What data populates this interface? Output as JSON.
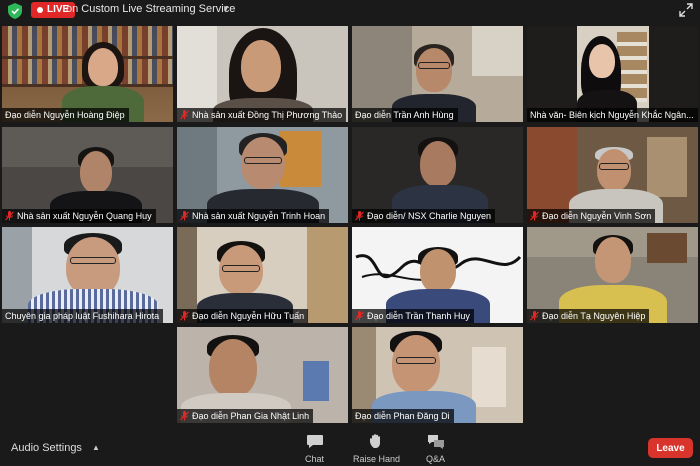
{
  "top_bar": {
    "live_label": "LIVE",
    "stream_text": "on Custom Live Streaming Service"
  },
  "participants": [
    {
      "name": "Đạo diễn Nguyễn Hoàng Điệp",
      "muted": false
    },
    {
      "name": "Nhà sản xuất Đồng Thị Phương Thảo",
      "muted": true
    },
    {
      "name": "Đạo diễn Trần Anh Hùng",
      "muted": false
    },
    {
      "name": "Nhà văn- Biên kịch Nguyễn Khắc Ngân...",
      "muted": false
    },
    {
      "name": "Nhà sản xuất Nguyễn Quang Huy",
      "muted": true
    },
    {
      "name": "Nhà sản xuất Nguyễn Trinh Hoan",
      "muted": true
    },
    {
      "name": "Đạo diễn/ NSX Charlie Nguyen",
      "muted": true
    },
    {
      "name": "Đạo diễn Nguyễn Vinh Sơn",
      "muted": true
    },
    {
      "name": "Chuyên gia pháp luật Fushihara Hirota",
      "muted": false
    },
    {
      "name": "Đạo diễn Nguyễn Hữu Tuấn",
      "muted": true
    },
    {
      "name": "Đạo diễn Trần Thanh Huy",
      "muted": true
    },
    {
      "name": "Đạo diễn Tạ Nguyên Hiệp",
      "muted": true
    },
    {
      "name": "Đạo diễn Phan Gia Nhật Linh",
      "muted": true
    },
    {
      "name": "Đạo diễn Phan Đăng Di",
      "muted": false,
      "active_speaker": true
    }
  ],
  "bottom_bar": {
    "audio_settings_label": "Audio Settings",
    "chat_label": "Chat",
    "raise_hand_label": "Raise Hand",
    "qa_label": "Q&A",
    "leave_label": "Leave"
  },
  "colors": {
    "live": "#e02828",
    "leave": "#d9342b",
    "active_speaker_border": "#e6e03a",
    "mute_icon": "#e02828"
  }
}
